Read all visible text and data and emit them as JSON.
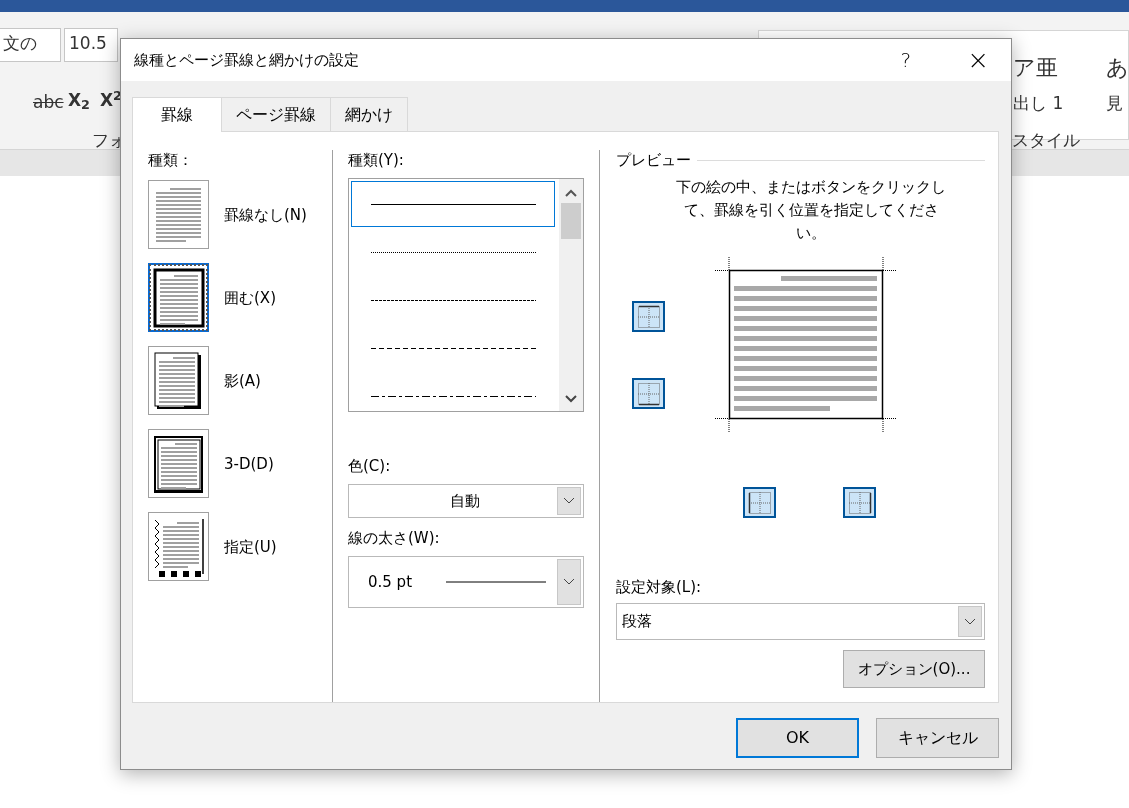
{
  "word_background": {
    "font_name": "文の",
    "font_size": "10.5",
    "strike_sample": "abc",
    "subscript_sample": "X$_{2}$",
    "superscript_sample": "X$^{2}$",
    "font_group": "フォ",
    "style_samples": [
      {
        "sample": "ア亜",
        "name": "出し 1"
      },
      {
        "sample": "あ",
        "name": "見"
      }
    ],
    "style_group": "スタイル"
  },
  "dialog": {
    "title": "線種とページ罫線と網かけの設定",
    "help": "?",
    "close": "×"
  },
  "tabs": [
    {
      "label": "罫線",
      "selected": true
    },
    {
      "label": "ページ罫線",
      "selected": false
    },
    {
      "label": "網かけ",
      "selected": false
    }
  ],
  "settings": {
    "label": "種類：",
    "items": [
      {
        "label": "罫線なし(N)",
        "kind": "none",
        "selected": false
      },
      {
        "label": "囲む(X)",
        "kind": "box",
        "selected": true
      },
      {
        "label": "影(A)",
        "kind": "shadow",
        "selected": false
      },
      {
        "label": "3-D(D)",
        "kind": "double",
        "selected": false
      },
      {
        "label": "指定(U)",
        "kind": "custom",
        "selected": false
      }
    ]
  },
  "line_style": {
    "label": "種類(Y):",
    "items": [
      {
        "kind": "solid",
        "selected": true
      },
      {
        "kind": "dotted",
        "selected": false
      },
      {
        "kind": "fine-dashed",
        "selected": false
      },
      {
        "kind": "dashed",
        "selected": false
      },
      {
        "kind": "dash-dot",
        "selected": false
      }
    ]
  },
  "color": {
    "label": "色(C):",
    "value": "自動"
  },
  "width": {
    "label": "線の太さ(W):",
    "value": "0.5 pt"
  },
  "preview": {
    "label": "プレビュー",
    "instructions": "下の絵の中、またはボタンをクリックして、罫線を引く位置を指定してください。",
    "borders": [
      {
        "kind": "top",
        "on": true
      },
      {
        "kind": "bottom",
        "on": true
      },
      {
        "kind": "left",
        "on": true
      },
      {
        "kind": "right",
        "on": true
      }
    ]
  },
  "apply_to": {
    "label": "設定対象(L):",
    "value": "段落"
  },
  "options_button": "オプション(O)...",
  "buttons": [
    {
      "label": "OK",
      "default": true
    },
    {
      "label": "キャンセル",
      "default": false
    }
  ]
}
